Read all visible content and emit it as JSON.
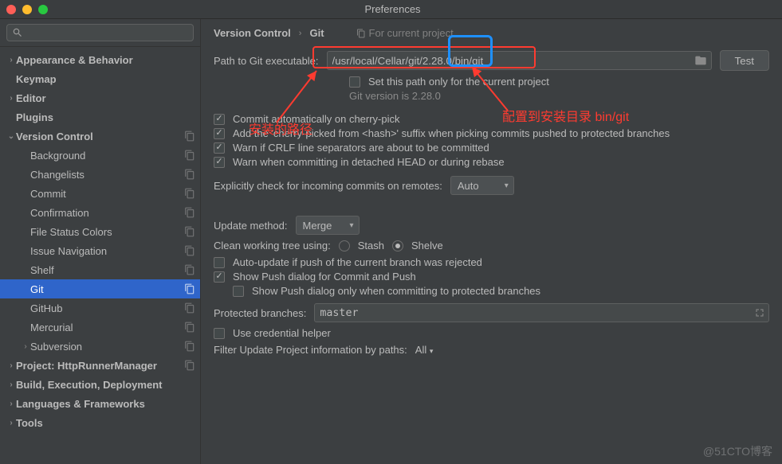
{
  "window": {
    "title": "Preferences"
  },
  "breadcrumb": {
    "section": "Version Control",
    "page": "Git",
    "scope": "For current project"
  },
  "sidebar": {
    "items": [
      {
        "label": "Appearance & Behavior",
        "bold": true,
        "arrow": "›",
        "indent": 0
      },
      {
        "label": "Keymap",
        "bold": true,
        "indent": 0
      },
      {
        "label": "Editor",
        "bold": true,
        "arrow": "›",
        "indent": 0
      },
      {
        "label": "Plugins",
        "bold": true,
        "indent": 0
      },
      {
        "label": "Version Control",
        "bold": true,
        "arrow": "⌄",
        "indent": 0,
        "copy": true
      },
      {
        "label": "Background",
        "indent": 1,
        "copy": true
      },
      {
        "label": "Changelists",
        "indent": 1,
        "copy": true
      },
      {
        "label": "Commit",
        "indent": 1,
        "copy": true
      },
      {
        "label": "Confirmation",
        "indent": 1,
        "copy": true
      },
      {
        "label": "File Status Colors",
        "indent": 1,
        "copy": true
      },
      {
        "label": "Issue Navigation",
        "indent": 1,
        "copy": true
      },
      {
        "label": "Shelf",
        "indent": 1,
        "copy": true
      },
      {
        "label": "Git",
        "indent": 1,
        "copy": true,
        "selected": true
      },
      {
        "label": "GitHub",
        "indent": 1,
        "copy": true
      },
      {
        "label": "Mercurial",
        "indent": 1,
        "copy": true
      },
      {
        "label": "Subversion",
        "arrow": "›",
        "indent": 1,
        "copy": true
      },
      {
        "label": "Project: HttpRunnerManager",
        "bold": true,
        "arrow": "›",
        "indent": 0,
        "copy": true
      },
      {
        "label": "Build, Execution, Deployment",
        "bold": true,
        "arrow": "›",
        "indent": 0
      },
      {
        "label": "Languages & Frameworks",
        "bold": true,
        "arrow": "›",
        "indent": 0
      },
      {
        "label": "Tools",
        "bold": true,
        "arrow": "›",
        "indent": 0
      }
    ]
  },
  "git": {
    "path_label": "Path to Git executable:",
    "path_value": "/usr/local/Cellar/git/2.28.0/bin/git",
    "test_btn": "Test",
    "set_path_only": "Set this path only for the current project",
    "version_info": "Git version is 2.28.0",
    "commit_auto": "Commit automatically on cherry-pick",
    "cherry_suffix": "Add the 'cherry-picked from <hash>' suffix when picking commits pushed to protected branches",
    "warn_crlf": "Warn if CRLF line separators are about to be committed",
    "warn_detached": "Warn when committing in detached HEAD or during rebase",
    "explicit_check": "Explicitly check for incoming commits on remotes:",
    "explicit_value": "Auto",
    "update_method_label": "Update method:",
    "update_method_value": "Merge",
    "clean_tree_label": "Clean working tree using:",
    "clean_stash": "Stash",
    "clean_shelve": "Shelve",
    "auto_update": "Auto-update if push of the current branch was rejected",
    "show_push": "Show Push dialog for Commit and Push",
    "show_push_protected": "Show Push dialog only when committing to protected branches",
    "protected_label": "Protected branches:",
    "protected_value": "master",
    "credential_helper": "Use credential helper",
    "filter_label": "Filter Update Project information by paths:",
    "filter_value": "All"
  },
  "annotations": {
    "left": "安装的路径",
    "right": "配置到安装目录 bin/git"
  },
  "watermark": "@51CTO博客"
}
